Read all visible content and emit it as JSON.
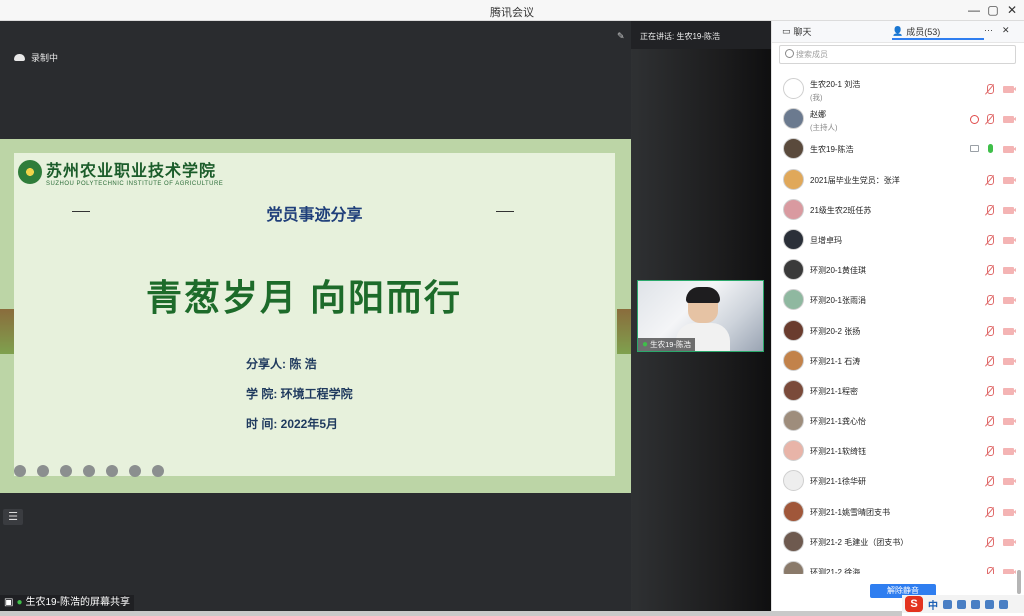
{
  "window": {
    "title": "腾讯会议",
    "min": "—",
    "max": "▢",
    "close": "✕"
  },
  "recording": {
    "label": "录制中"
  },
  "slide": {
    "school_cn": "苏州农业职业技术学院",
    "school_en": "SUZHOU POLYTECHNIC INSTITUTE OF AGRICULTURE",
    "subtitle": "党员事迹分享",
    "main_title": "青葱岁月 向阳而行",
    "speaker_line": "分享人:  陈 浩",
    "college_line": "学   院:  环境工程学院",
    "time_line": "时   间:  2022年5月"
  },
  "share_label": "生农19-陈浩的屏幕共享",
  "speaking": {
    "prefix": "正在讲话: 生农19-陈浩"
  },
  "video_tile": {
    "name": "生农19-陈浩"
  },
  "panel": {
    "tab_chat": "聊天",
    "tab_members": "成员(53)",
    "more": "···",
    "close": "✕",
    "search_placeholder": "搜索成员",
    "unmute_all": "解除静音",
    "members": [
      {
        "name": "生农20-1 刘浩",
        "sub": "(我)",
        "av": "#ffffff",
        "mic": "muted",
        "extra": ""
      },
      {
        "name": "赵娜",
        "sub": "(主持人)",
        "av": "#6b7a8f",
        "mic": "muted",
        "extra": "share"
      },
      {
        "name": "生农19-陈浩",
        "sub": "",
        "av": "#5a4a3c",
        "mic": "on",
        "extra": "screen"
      },
      {
        "name": "2021届毕业生党员：张洋",
        "sub": "",
        "av": "#e0a85a",
        "mic": "muted",
        "extra": ""
      },
      {
        "name": "21级生农2班任苏",
        "sub": "",
        "av": "#d99aa0",
        "mic": "muted",
        "extra": ""
      },
      {
        "name": "旦增卓玛",
        "sub": "",
        "av": "#2a2f38",
        "mic": "muted",
        "extra": ""
      },
      {
        "name": "环测20-1黄佳琪",
        "sub": "",
        "av": "#3a3a3a",
        "mic": "muted",
        "extra": ""
      },
      {
        "name": "环测20-1张雨涓",
        "sub": "",
        "av": "#8fb8a0",
        "mic": "muted",
        "extra": ""
      },
      {
        "name": "环测20-2 张扬",
        "sub": "",
        "av": "#6a3c2e",
        "mic": "muted",
        "extra": ""
      },
      {
        "name": "环测21-1 石涛",
        "sub": "",
        "av": "#c2824a",
        "mic": "muted",
        "extra": ""
      },
      {
        "name": "环测21-1程密",
        "sub": "",
        "av": "#7a4a3a",
        "mic": "muted",
        "extra": ""
      },
      {
        "name": "环测21-1龚心怡",
        "sub": "",
        "av": "#9e8d7c",
        "mic": "muted",
        "extra": ""
      },
      {
        "name": "环测21-1软绮钰",
        "sub": "",
        "av": "#e8b4a8",
        "mic": "muted",
        "extra": ""
      },
      {
        "name": "环测21-1徐华研",
        "sub": "",
        "av": "#eeeeee",
        "mic": "muted",
        "extra": ""
      },
      {
        "name": "环测21-1姚雪晴团支书",
        "sub": "",
        "av": "#a0573a",
        "mic": "muted",
        "extra": ""
      },
      {
        "name": "环测21-2 毛建业（团支书）",
        "sub": "",
        "av": "#6e5a4f",
        "mic": "muted",
        "extra": ""
      },
      {
        "name": "环测21-2 徐海",
        "sub": "",
        "av": "#8a7a6a",
        "mic": "muted",
        "extra": ""
      }
    ]
  },
  "tray": {
    "ime_brand": "S",
    "ime_lang": "中"
  }
}
